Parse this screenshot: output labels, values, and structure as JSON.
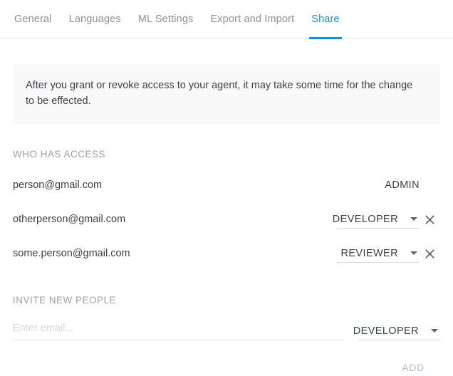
{
  "tabs": [
    {
      "label": "General",
      "active": false
    },
    {
      "label": "Languages",
      "active": false
    },
    {
      "label": "ML Settings",
      "active": false
    },
    {
      "label": "Export and Import",
      "active": false
    },
    {
      "label": "Share",
      "active": true
    }
  ],
  "notice": {
    "text": "After you grant or revoke access to your agent, it may take some time for the change to be effected."
  },
  "who_has_access": {
    "title": "WHO HAS ACCESS",
    "rows": [
      {
        "email": "person@gmail.com",
        "role": "ADMIN",
        "editable": false,
        "removable": false
      },
      {
        "email": "otherperson@gmail.com",
        "role": "DEVELOPER",
        "editable": true,
        "removable": true
      },
      {
        "email": "some.person@gmail.com",
        "role": "REVIEWER",
        "editable": true,
        "removable": true
      }
    ]
  },
  "invite": {
    "title": "INVITE NEW PEOPLE",
    "email_placeholder": "Enter email...",
    "email_value": "",
    "role": "DEVELOPER",
    "add_label": "ADD"
  },
  "colors": {
    "accent": "#1a8cdc",
    "tab_inactive": "#8a9199",
    "text": "#3c4043",
    "section_label": "#9aa2ae",
    "notice_bg": "#f9f9fa",
    "add_disabled": "#b6bcc6"
  }
}
